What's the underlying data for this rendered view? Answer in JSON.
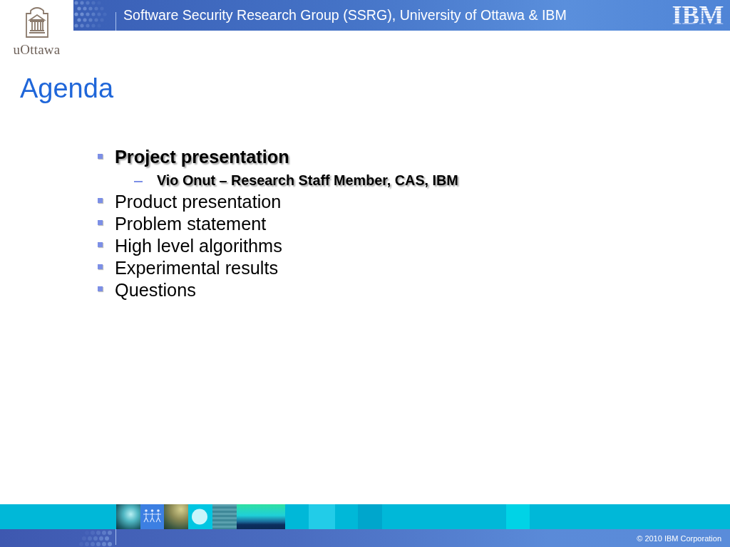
{
  "header": {
    "logo_text": "uOttawa",
    "title": "Software Security Research Group (SSRG), University of Ottawa & IBM",
    "brand": "IBM"
  },
  "slide": {
    "title": "Agenda",
    "items": [
      {
        "text": "Project presentation",
        "emphasized": true,
        "children": [
          {
            "text": "Vio Onut – Research Staff Member, CAS, IBM",
            "emphasized": true
          }
        ]
      },
      {
        "text": "Product presentation",
        "emphasized": false
      },
      {
        "text": "Problem statement",
        "emphasized": false
      },
      {
        "text": "High level algorithms",
        "emphasized": false
      },
      {
        "text": "Experimental results",
        "emphasized": false
      },
      {
        "text": "Questions",
        "emphasized": false
      }
    ]
  },
  "footer": {
    "copyright": "© 2010 IBM Corporation"
  }
}
